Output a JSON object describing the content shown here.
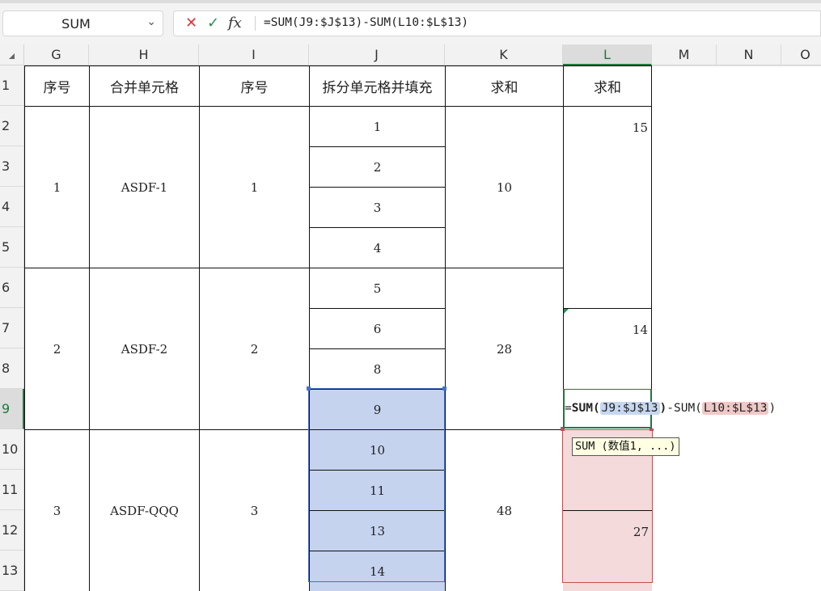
{
  "name_box": {
    "value": "SUM"
  },
  "formula_bar": {
    "cancel_icon": "✕",
    "confirm_icon": "✓",
    "fx_icon": "fx",
    "formula": "=SUM(J9:$J$13)-SUM(L10:$L$13)"
  },
  "columns": [
    "G",
    "H",
    "I",
    "J",
    "K",
    "L",
    "M",
    "N",
    "O"
  ],
  "rows": [
    "1",
    "2",
    "3",
    "4",
    "5",
    "6",
    "7",
    "8",
    "9",
    "10",
    "11",
    "12",
    "13"
  ],
  "headers": {
    "g": "序号",
    "h": "合并单元格",
    "i": "序号",
    "j": "拆分单元格并填充",
    "k": "求和",
    "l": "求和"
  },
  "groups": [
    {
      "seq": "1",
      "name": "ASDF-1",
      "seq2": "1",
      "sum": "10"
    },
    {
      "seq": "2",
      "name": "ASDF-2",
      "seq2": "2",
      "sum": "28"
    },
    {
      "seq": "3",
      "name": "ASDF-QQQ",
      "seq2": "3",
      "sum": "48"
    }
  ],
  "j_values": [
    "1",
    "2",
    "3",
    "4",
    "5",
    "6",
    "8",
    "9",
    "10",
    "11",
    "13",
    "14"
  ],
  "l_values": {
    "r2": "15",
    "r7": "14",
    "r12": "27"
  },
  "edit": {
    "eq": "=",
    "fn1": "SUM",
    "open1": "(",
    "ref1": "J9:$J$13",
    "close1": ")",
    "mid": "-SUM(",
    "ref2": "L10:$L$13",
    "close2": ")"
  },
  "tooltip": {
    "text": "SUM (数值1, ...)"
  }
}
